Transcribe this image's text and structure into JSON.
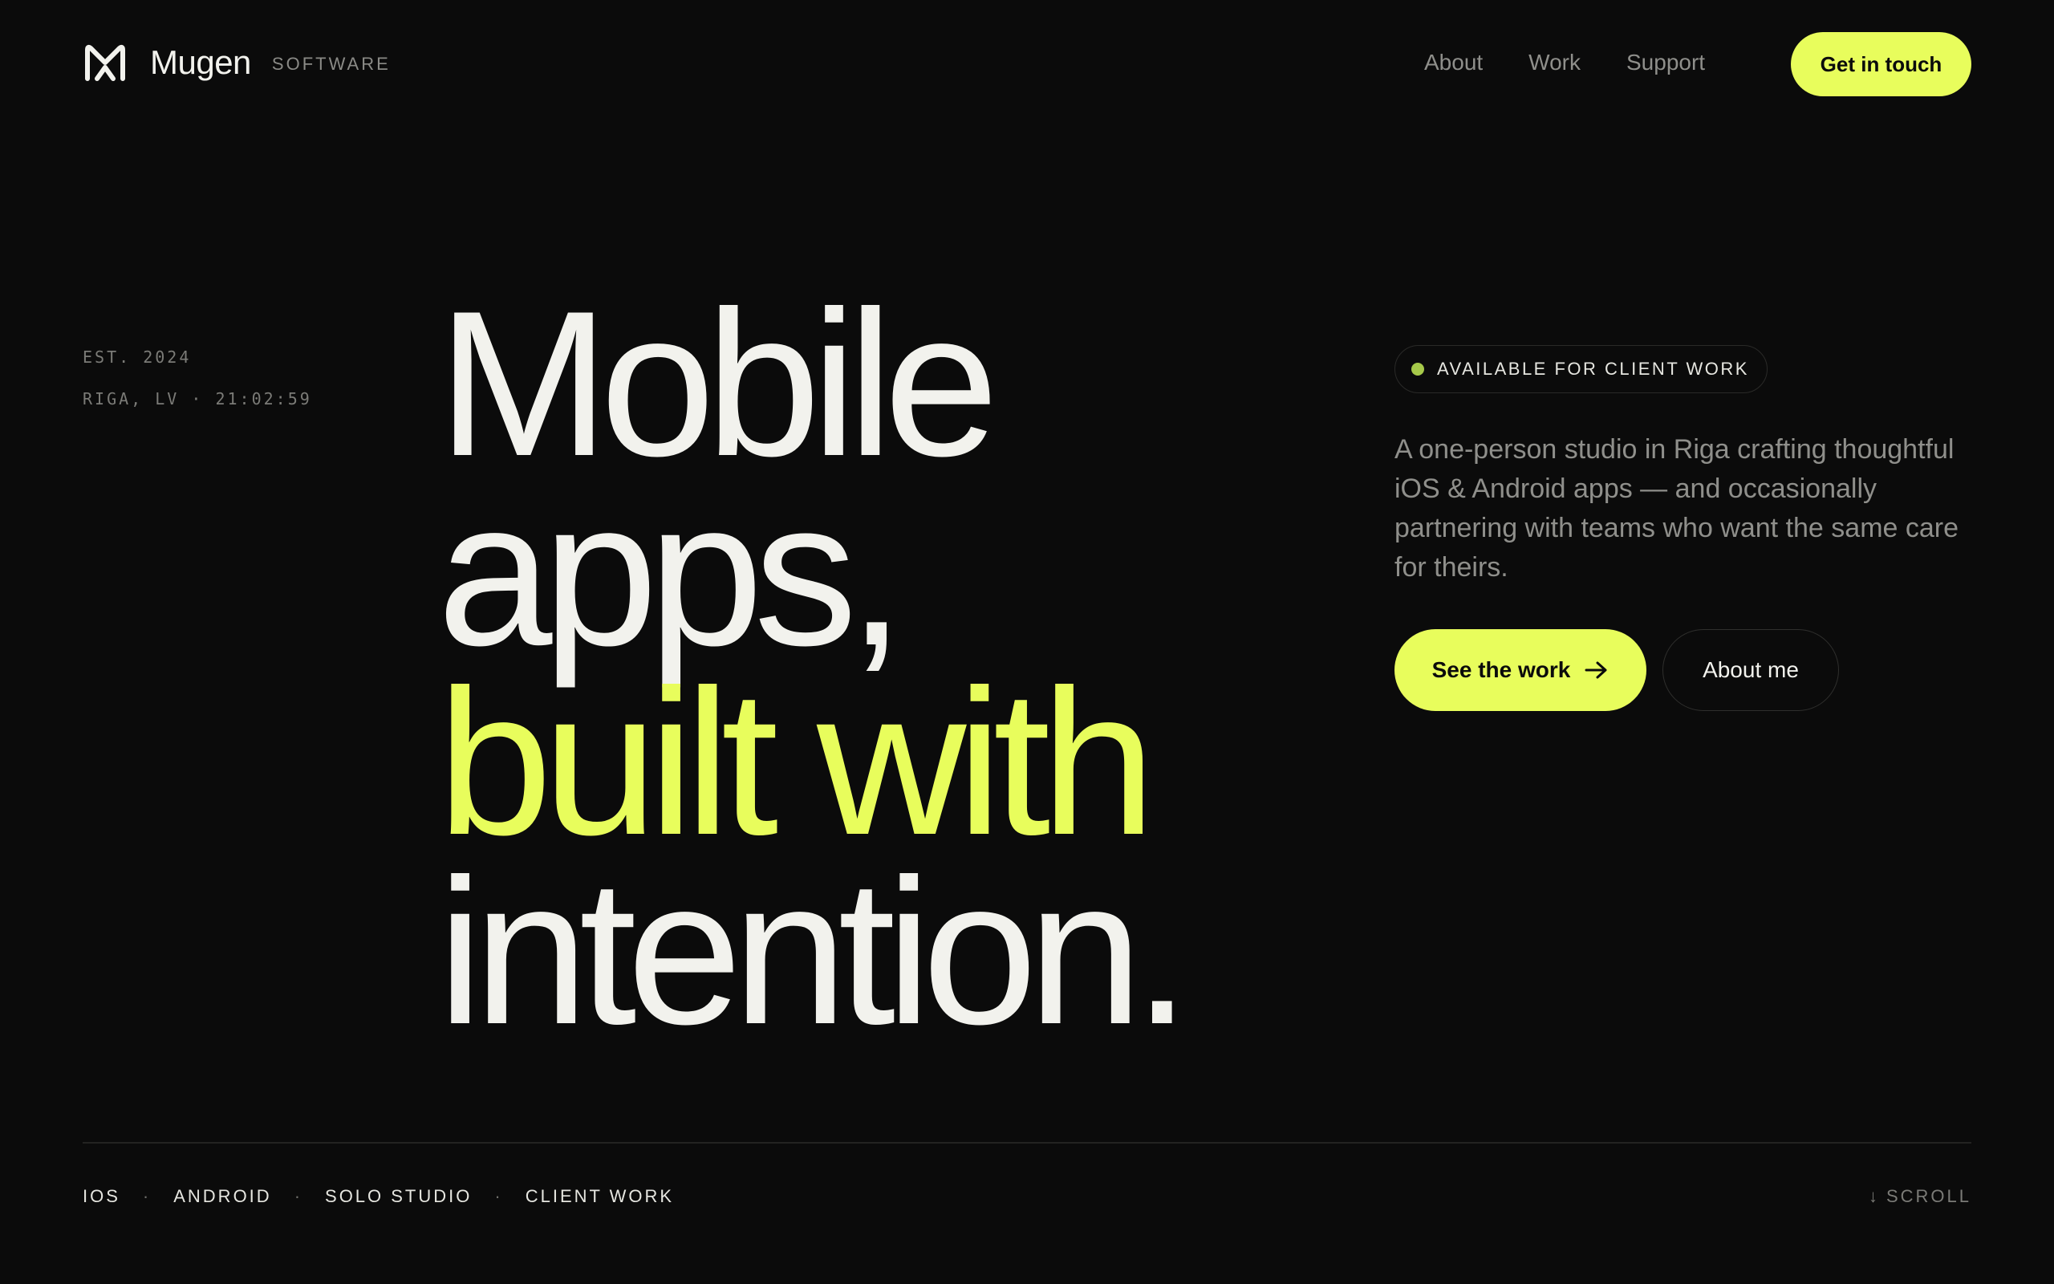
{
  "colors": {
    "background": "#0b0b0b",
    "accent": "#e8fd5c",
    "text": "#f2f2ed",
    "muted": "#8f8f8b",
    "status_dot": "#a6c94a"
  },
  "header": {
    "brand_name": "Mugen",
    "brand_sub": "SOFTWARE",
    "logo_icon": "mugen-m-logo-icon",
    "nav": [
      {
        "label": "About"
      },
      {
        "label": "Work"
      },
      {
        "label": "Support"
      }
    ],
    "cta_label": "Get in touch"
  },
  "meta": {
    "established": "EST. 2024",
    "location_time": "RIGA, LV · 21:02:59"
  },
  "hero": {
    "line1": "Mobile",
    "line2": "apps,",
    "line3": "built with",
    "line4": "intention."
  },
  "status": {
    "label": "AVAILABLE FOR CLIENT WORK"
  },
  "intro": {
    "description": "A one-person studio in Riga crafting thoughtful iOS & Android apps — and occasionally partnering with teams who want the same care for theirs.",
    "primary_button": "See the work",
    "primary_icon": "arrow-right-icon",
    "secondary_button": "About me"
  },
  "footer": {
    "tags": [
      "IOS",
      "ANDROID",
      "SOLO STUDIO",
      "CLIENT WORK"
    ],
    "separator": "·",
    "scroll_arrow": "↓",
    "scroll_label": "SCROLL"
  }
}
